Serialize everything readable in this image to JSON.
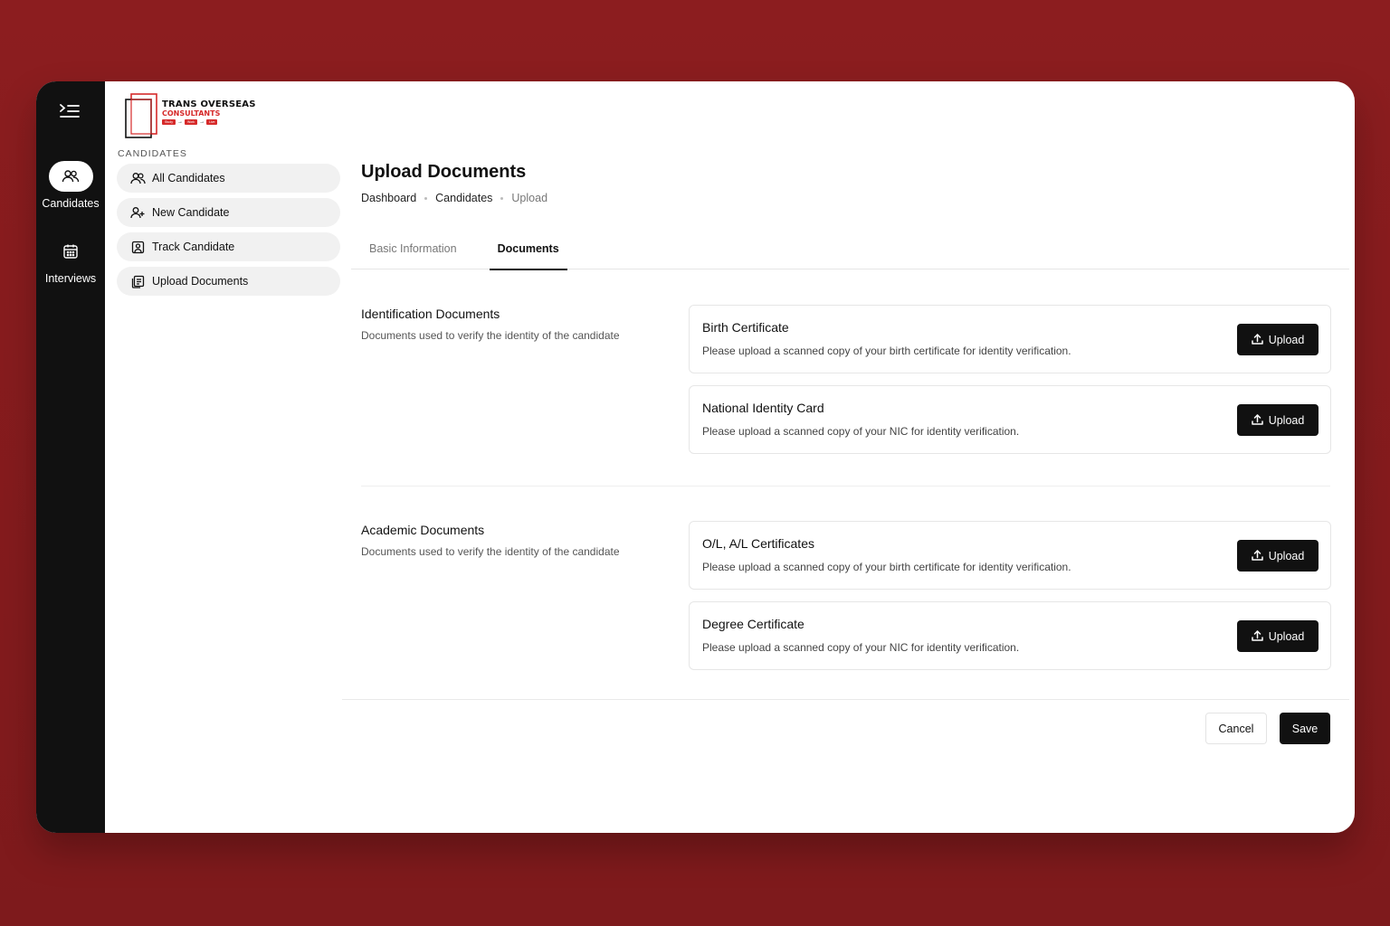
{
  "brand": {
    "line1": "TRANS OVERSEAS",
    "line2": "CONSULTANTS",
    "tags": [
      "Study",
      "Work",
      "Live"
    ],
    "accent": "#d62a2a"
  },
  "rail": {
    "items": [
      {
        "label": "Candidates",
        "icon": "users-icon",
        "active": true
      },
      {
        "label": "Interviews",
        "icon": "calendar-icon",
        "active": false
      }
    ]
  },
  "sidebar": {
    "section_label": "CANDIDATES",
    "items": [
      {
        "label": "All Candidates",
        "icon": "users-icon"
      },
      {
        "label": "New Candidate",
        "icon": "user-plus-icon"
      },
      {
        "label": "Track Candidate",
        "icon": "user-square-icon"
      },
      {
        "label": "Upload Documents",
        "icon": "documents-icon"
      }
    ]
  },
  "page": {
    "title": "Upload Documents",
    "breadcrumb": [
      "Dashboard",
      "Candidates",
      "Upload"
    ]
  },
  "tabs": [
    {
      "label": "Basic Information",
      "active": false
    },
    {
      "label": "Documents",
      "active": true
    }
  ],
  "sections": [
    {
      "title": "Identification Documents",
      "description": "Documents used to verify the identity of the candidate",
      "documents": [
        {
          "title": "Birth Certificate",
          "description": "Please upload a scanned copy of your birth certificate for identity verification.",
          "button": "Upload"
        },
        {
          "title": "National Identity Card",
          "description": "Please upload a scanned copy of your NIC for identity verification.",
          "button": "Upload"
        }
      ]
    },
    {
      "title": "Academic Documents",
      "description": "Documents used to verify the identity of the candidate",
      "documents": [
        {
          "title": "O/L, A/L Certificates",
          "description": "Please upload a scanned copy of your birth certificate for identity verification.",
          "button": "Upload"
        },
        {
          "title": "Degree Certificate",
          "description": "Please upload a scanned copy of your NIC for identity verification.",
          "button": "Upload"
        }
      ]
    }
  ],
  "footer": {
    "cancel_label": "Cancel",
    "save_label": "Save"
  }
}
